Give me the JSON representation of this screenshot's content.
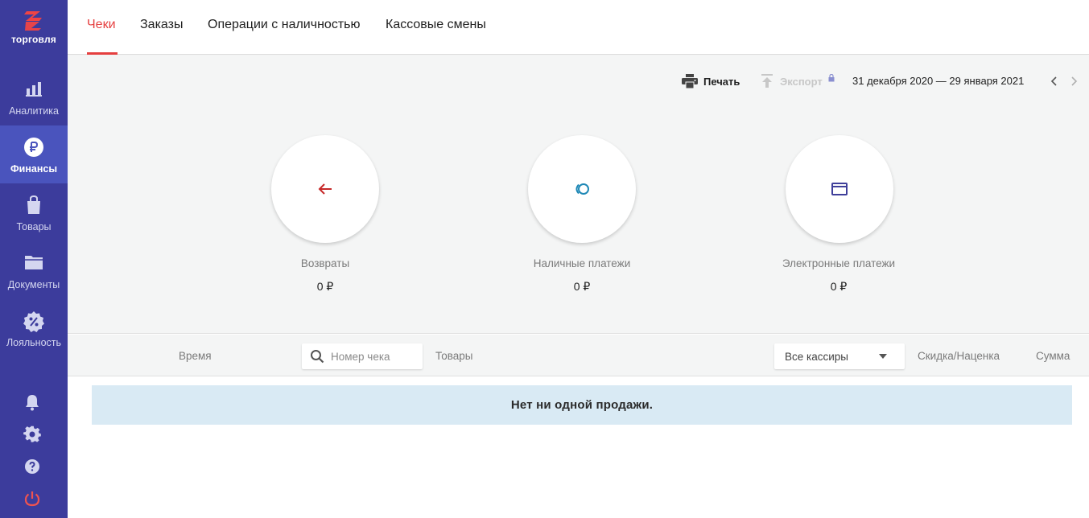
{
  "app": {
    "logo_text": "торговля"
  },
  "sidebar": {
    "items": [
      {
        "label": "Аналитика",
        "icon": "bar-chart-icon",
        "active": false
      },
      {
        "label": "Финансы",
        "icon": "ruble-icon",
        "active": true
      },
      {
        "label": "Товары",
        "icon": "shopping-bag-icon",
        "active": false
      },
      {
        "label": "Документы",
        "icon": "folder-icon",
        "active": false
      },
      {
        "label": "Лояльность",
        "icon": "discount-badge-icon",
        "active": false
      }
    ],
    "bottom_icons": [
      "bell-icon",
      "gear-icon",
      "help-icon",
      "power-icon"
    ]
  },
  "tabs": [
    {
      "label": "Чеки",
      "active": true
    },
    {
      "label": "Заказы",
      "active": false
    },
    {
      "label": "Операции с наличностью",
      "active": false
    },
    {
      "label": "Кассовые смены",
      "active": false
    }
  ],
  "toolbar": {
    "print_label": "Печать",
    "export_label": "Экспорт",
    "date_range": "31 декабря 2020 — 29 января 2021"
  },
  "metrics": [
    {
      "label": "Возвраты",
      "value": "0 ₽",
      "icon": "arrow-left-icon",
      "color": "#c62828"
    },
    {
      "label": "Наличные платежи",
      "value": "0 ₽",
      "icon": "coins-icon",
      "color": "#1e88b6"
    },
    {
      "label": "Электронные платежи",
      "value": "0 ₽",
      "icon": "credit-card-icon",
      "color": "#3f3f9a"
    }
  ],
  "table": {
    "col_time": "Время",
    "search_placeholder": "Номер чека",
    "col_goods": "Товары",
    "cashier_select": "Все кассиры",
    "col_discount": "Скидка/Наценка",
    "col_sum": "Сумма"
  },
  "empty_message": "Нет ни одной продажи.",
  "colors": {
    "sidebar_bg": "#3c3c9c",
    "sidebar_active": "#4a54bd",
    "accent": "#e53f3f",
    "empty_bg": "#d9eaf4"
  }
}
